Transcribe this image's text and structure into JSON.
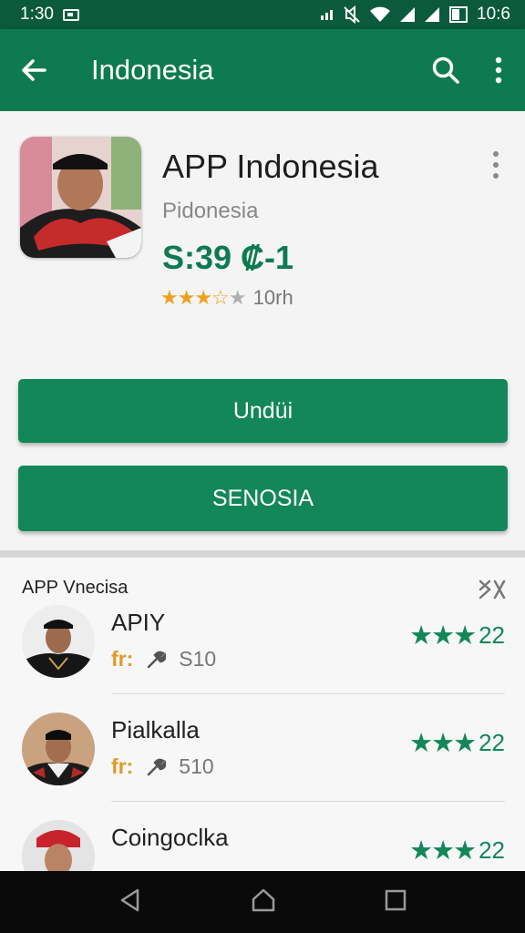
{
  "status_bar": {
    "time": "1:30",
    "clock": "10:6",
    "icons": [
      "notification-icon",
      "data-icon",
      "mute-icon",
      "wifi-icon",
      "signal-icon",
      "signal-icon",
      "battery-icon"
    ]
  },
  "app_bar": {
    "title": "Indonesia",
    "icons": [
      "back-arrow-icon",
      "search-icon",
      "more-vert-icon"
    ],
    "color": "#0e7a52"
  },
  "app": {
    "name": "APP Indonesia",
    "developer": "Pidonesia",
    "price": "S:39 ₡-1",
    "rating_stars": 3.5,
    "rating_count": "10rh",
    "icon": "app-icon-portrait"
  },
  "buttons": {
    "install": "Undüi",
    "secondary": "SENOSIA"
  },
  "similar": {
    "title": "APP Vnecisa",
    "close_icon": "close-icon",
    "items": [
      {
        "name": "APIY",
        "badge": "fr:",
        "size": "S10",
        "rating": "22",
        "stars": 3
      },
      {
        "name": "Pialkalla",
        "badge": "fr:",
        "size": "510",
        "rating": "22",
        "stars": 3
      },
      {
        "name": "Coingoclka",
        "badge": "",
        "size": "",
        "rating": "22",
        "stars": 3
      }
    ]
  },
  "nav_bar": {
    "icons": [
      "back-triangle-icon",
      "home-icon",
      "recents-icon"
    ]
  },
  "colors": {
    "primary": "#13875a",
    "dark": "#0b5a3d",
    "star": "#f0a020"
  }
}
